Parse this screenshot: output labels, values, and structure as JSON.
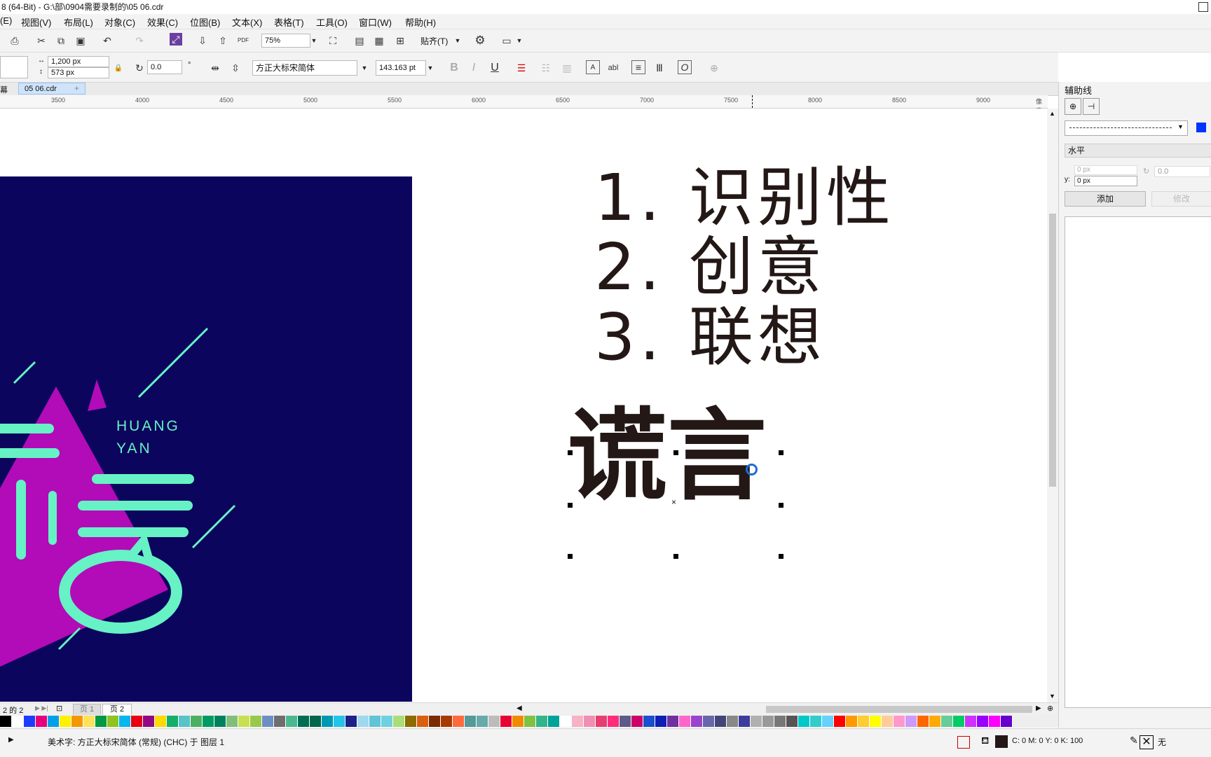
{
  "titlebar": {
    "text": "8 (64-Bit) - G:\\部\\0904需要录制的\\05 06.cdr"
  },
  "menu": [
    "(E)",
    "视图(V)",
    "布局(L)",
    "对象(C)",
    "效果(C)",
    "位图(B)",
    "文本(X)",
    "表格(T)",
    "工具(O)",
    "窗口(W)",
    "帮助(H)"
  ],
  "toolbar1": {
    "zoom_value": "75%",
    "snap_label": "贴齐(T)",
    "pdf_label": "PDF"
  },
  "toolbar2": {
    "width_value": "1,200 px",
    "height_value": "573 px",
    "rotation_value": "0.0",
    "font_name": "方正大标宋简体",
    "font_size": "143.163 pt",
    "bold_label": "B",
    "italic_label": "I",
    "underline_label": "U",
    "abl_label": "abl"
  },
  "tabs": {
    "left_label": "幕",
    "doc_tab": "05 06.cdr",
    "add_tab": "+"
  },
  "ruler": {
    "ticks": [
      "3500",
      "4000",
      "4500",
      "5000",
      "5500",
      "6000",
      "6500",
      "7000",
      "7500",
      "8000",
      "8500",
      "9000"
    ],
    "unit": "像素"
  },
  "canvas": {
    "artwork_text_1": "HUANG",
    "artwork_text_2": "YAN",
    "list": [
      "1. 识别性",
      "2. 创意",
      "3. 联想"
    ],
    "selected_text": "谎言"
  },
  "pages": {
    "counter": "2 的 2",
    "page1": "页 1",
    "page2": "页 2"
  },
  "palette": [
    "#000000",
    "#ffffff",
    "#1e3cff",
    "#e6007e",
    "#00a0e9",
    "#fff100",
    "#f39800",
    "#ffe15a",
    "#009944",
    "#8fc31f",
    "#00b7ee",
    "#e60012",
    "#920783",
    "#ffd900",
    "#13ae67",
    "#58c3c8",
    "#4cb062",
    "#009b63",
    "#00815d",
    "#7fbf7b",
    "#c8e050",
    "#9ac84a",
    "#6b8fc5",
    "#6e6e6e",
    "#49b990",
    "#006e54",
    "#00674a",
    "#0097b2",
    "#23c4e8",
    "#1d2088",
    "#a0d8ef",
    "#60c4d6",
    "#70d0e0",
    "#aadd77",
    "#8c6b00",
    "#d95f0e",
    "#7a2b00",
    "#a63a00",
    "#ff6a3d",
    "#559999",
    "#66aaaa",
    "#bcbcbc",
    "#e60033",
    "#f08a00",
    "#7fc241",
    "#33b48a",
    "#00a29a",
    "#ffffff",
    "#f5b3c3",
    "#f08fb3",
    "#e63e70",
    "#ff2d7a",
    "#5c5c8a",
    "#cc0066",
    "#1a4fcf",
    "#0e1fb5",
    "#7030a0",
    "#ff66cc",
    "#9944cc",
    "#6666aa",
    "#444477",
    "#888888",
    "#3c3c9c",
    "#b0b0b0",
    "#999999",
    "#777777",
    "#555555",
    "#00c8c8",
    "#33cccc",
    "#66d0ff",
    "#ff0000",
    "#ff9900",
    "#ffcc33",
    "#ffff00",
    "#ffcc99",
    "#ff99cc",
    "#cc99ff",
    "#ff6600",
    "#ffaa00",
    "#66cc99",
    "#00cc66",
    "#cc33ff",
    "#9900ff",
    "#ff00ff",
    "#6600cc"
  ],
  "status": {
    "object_info": "美术字: 方正大标宋简体 (常规) (CHC) 于 图层 1",
    "color_info": "C: 0 M: 0 Y: 0 K: 100",
    "outline_info": "无"
  },
  "dock": {
    "title": "辅助线",
    "orientation": "水平",
    "x_value": "0 px",
    "y_label": "y:",
    "y_value": "0 px",
    "angle_value": "0.0",
    "add_button": "添加",
    "modify_button": "修改"
  },
  "colors": {
    "artwork_bg": "#0c055e",
    "mint": "#66f2c4",
    "magenta": "#b20bb8",
    "accent_blue": "#1e6bd6"
  }
}
